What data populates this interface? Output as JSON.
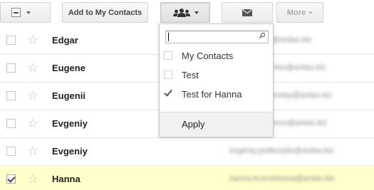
{
  "toolbar": {
    "add_to_contacts_label": "Add to My Contacts",
    "more_label": "More"
  },
  "contacts": [
    {
      "name": "Edgar",
      "email": "edgar.novak@ardas.biz",
      "selected": false
    },
    {
      "name": "Eugene",
      "email": "eugene.borenko@ardas.biz",
      "selected": false
    },
    {
      "name": "Eugenii",
      "email": "eugenii.marenskyi@ardas.biz",
      "selected": false
    },
    {
      "name": "Evgeniy",
      "email": "evgeniy.simenov@ardas.biz",
      "selected": false
    },
    {
      "name": "Evgeniy",
      "email": "evgeniy.podkorytin@ardas.biz",
      "selected": false
    },
    {
      "name": "Hanna",
      "email": "hanna.kuzmetsova@ardas.biz",
      "selected": true
    }
  ],
  "groups_dropdown": {
    "search_value": "",
    "items": [
      {
        "label": "My Contacts",
        "checked": false
      },
      {
        "label": "Test",
        "checked": false
      },
      {
        "label": "Test for Hanna",
        "checked": true
      }
    ],
    "apply_label": "Apply"
  }
}
